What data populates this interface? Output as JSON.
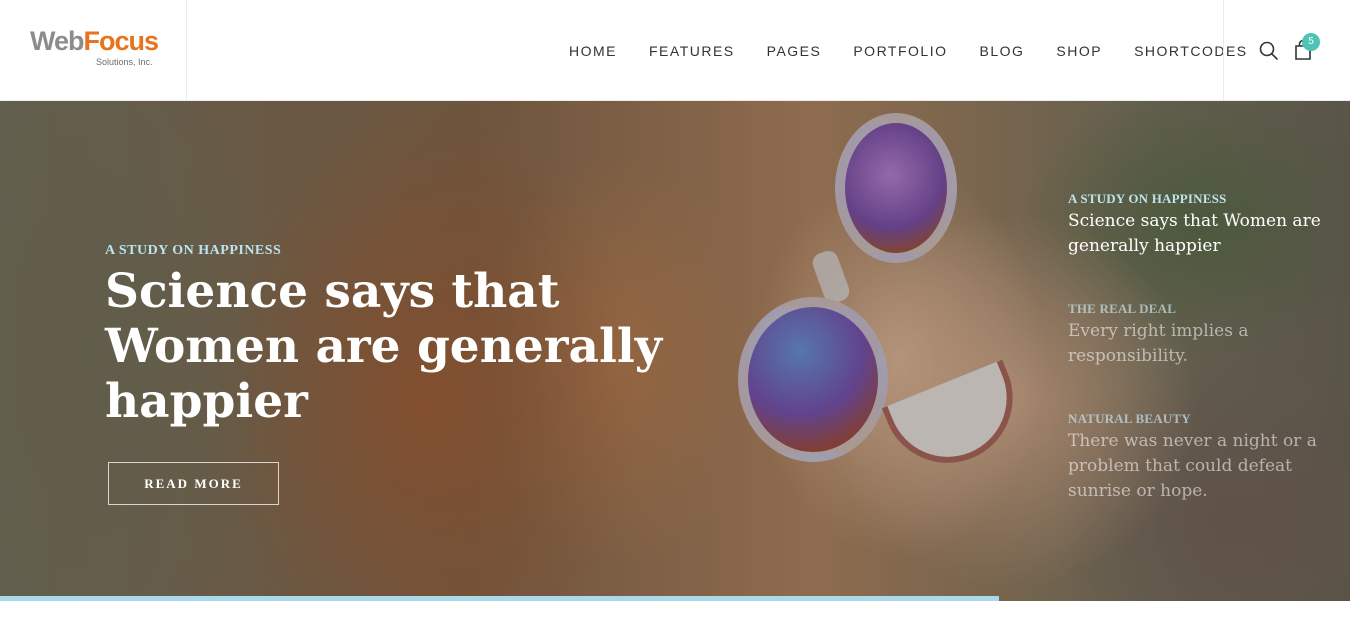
{
  "brand": {
    "word1": "Web",
    "word2": "Focus",
    "sub": "Solutions, Inc."
  },
  "nav": [
    "HOME",
    "FEATURES",
    "PAGES",
    "PORTFOLIO",
    "BLOG",
    "SHOP",
    "SHORTCODES"
  ],
  "cart": {
    "count": "5"
  },
  "hero": {
    "kicker": "A STUDY ON HAPPINESS",
    "title": "Science says that Women are generally happier",
    "button": "READ MORE"
  },
  "slides": [
    {
      "kicker": "A STUDY ON HAPPINESS",
      "title": "Science says that Women are generally happier",
      "active": true
    },
    {
      "kicker": "THE REAL DEAL",
      "title": "Every right implies a responsibility.",
      "active": false
    },
    {
      "kicker": "NATURAL BEAUTY",
      "title": "There was never a night or a problem that could defeat sunrise or hope.",
      "active": false
    }
  ],
  "slider_progress": 0.74,
  "colors": {
    "accent": "#4fc3b5",
    "kicker": "#bde3ee",
    "progress": "#a9d9ea",
    "logo_orange": "#e8731d"
  }
}
